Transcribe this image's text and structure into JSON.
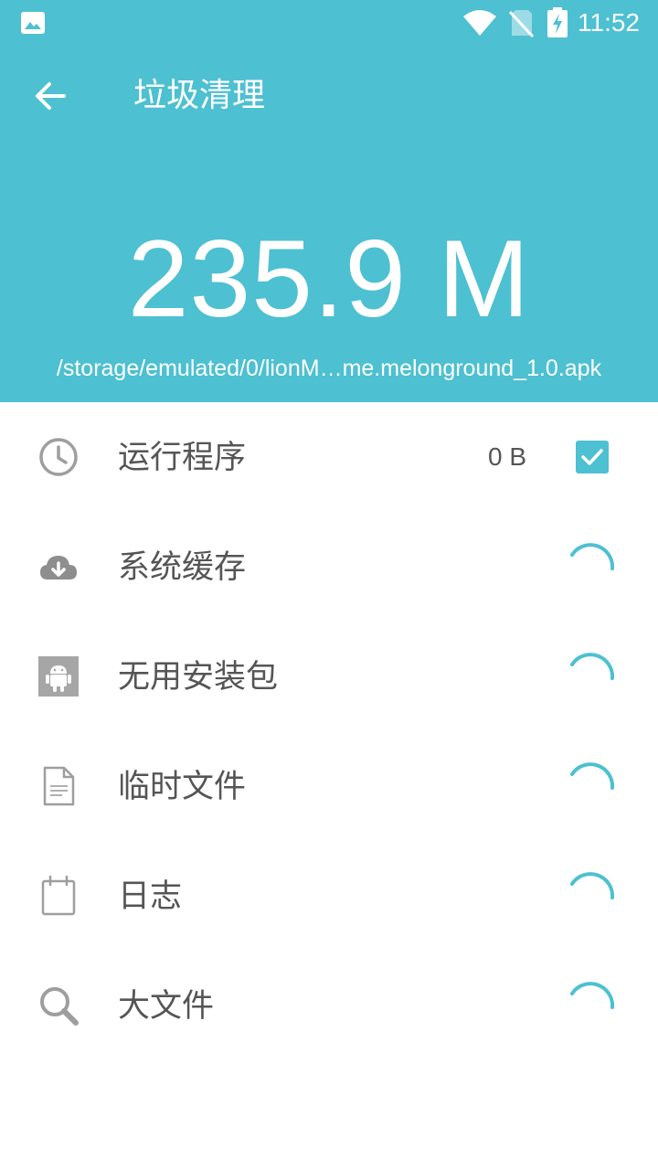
{
  "status_bar": {
    "time": "11:52",
    "icons": [
      "gallery-notification-icon",
      "wifi-icon",
      "no-sim-icon",
      "battery-charging-icon"
    ]
  },
  "header": {
    "title": "垃圾清理",
    "total_size": "235.9 M",
    "scan_path": "/storage/emulated/0/lionM…me.melonground_1.0.apk",
    "accent_color": "#4DC0D1"
  },
  "categories": [
    {
      "label": "运行程序",
      "value": "0 B",
      "icon": "clock-icon",
      "checked": true
    },
    {
      "label": "系统缓存",
      "icon": "cloud-download-icon",
      "loading": true
    },
    {
      "label": "无用安装包",
      "icon": "android-icon",
      "loading": true
    },
    {
      "label": "临时文件",
      "icon": "document-icon",
      "loading": true
    },
    {
      "label": "日志",
      "icon": "calendar-icon",
      "loading": true
    },
    {
      "label": "大文件",
      "icon": "search-icon",
      "loading": true
    }
  ]
}
